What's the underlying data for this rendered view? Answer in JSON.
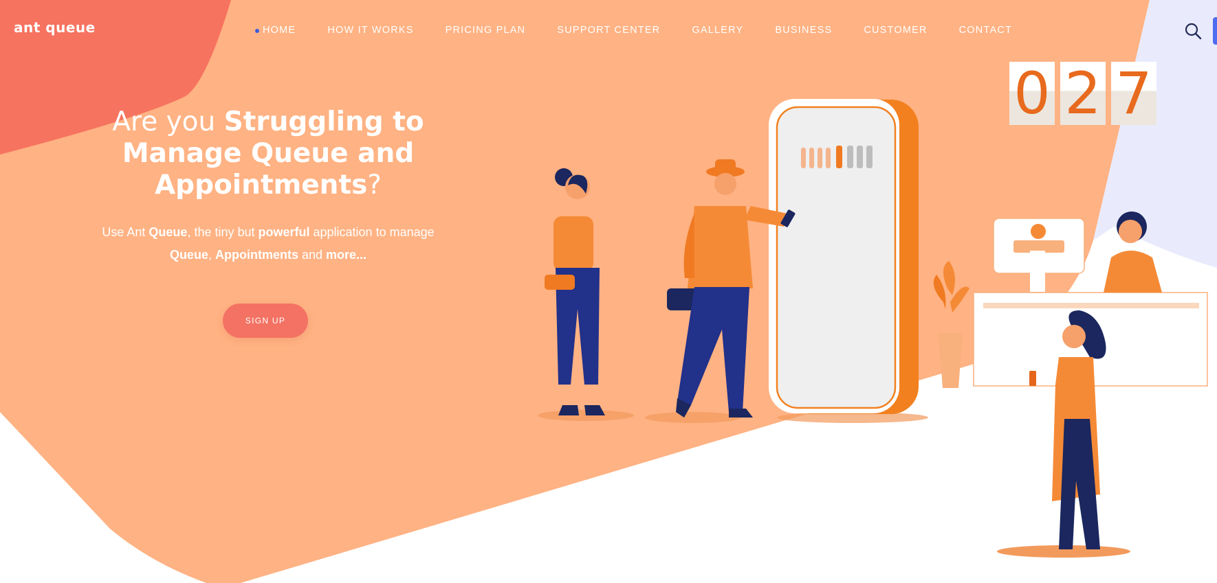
{
  "logo": "ant queue",
  "nav": {
    "items": [
      "HOME",
      "HOW IT WORKS",
      "PRICING PLAN",
      "SUPPORT CENTER",
      "GALLERY",
      "BUSINESS",
      "CUSTOMER",
      "CONTACT"
    ],
    "active": "HOME"
  },
  "hero": {
    "title_light_1": "Are you ",
    "title_bold_1": "Struggling to Manage Queue and Appointments",
    "title_light_2": "?",
    "sub_1": "Use Ant ",
    "sub_2": "Queue",
    "sub_3": ", the tiny but ",
    "sub_4": "powerful",
    "sub_5": " application to manage ",
    "sub_6": "Queue",
    "sub_7": ", ",
    "sub_8": "Appointments",
    "sub_9": " and ",
    "sub_10": "more...",
    "signup_label": "SIGN UP"
  },
  "counter": {
    "digits": [
      "0",
      "2",
      "7"
    ]
  },
  "icons": {
    "search": "search-icon"
  },
  "colors": {
    "hero_bg": "#ffb283",
    "coral": "#f6735f",
    "accent_blue": "#3a5bd9",
    "digit": "#e86a1e",
    "illustration_orange": "#f58a36",
    "illustration_navy": "#22318a"
  }
}
